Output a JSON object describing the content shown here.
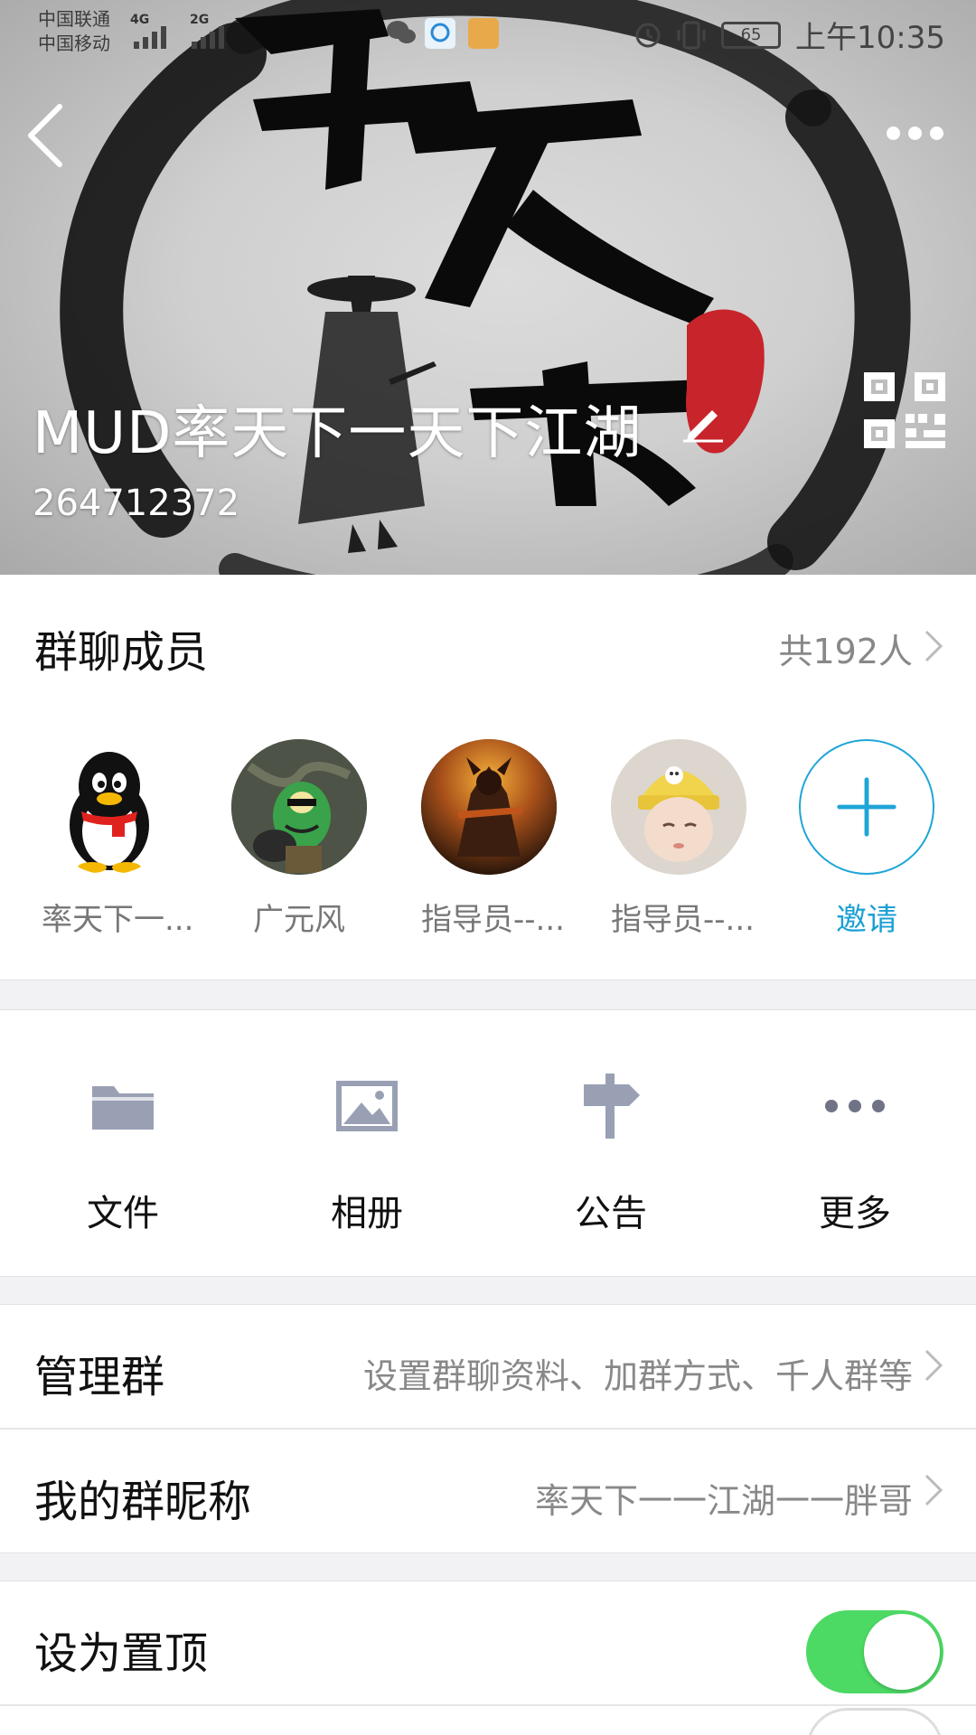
{
  "status_bar": {
    "carrier_1": "中国联通",
    "carrier_2": "中国移动",
    "net_1": "4G",
    "net_2": "2G",
    "battery": "65",
    "time": "上午10:35"
  },
  "header": {
    "group_name": "MUD率天下一天下江湖",
    "group_id": "264712372"
  },
  "members": {
    "title": "群聊成员",
    "count_label": "共192人",
    "items": [
      {
        "name": "率天下一..."
      },
      {
        "name": "广元风"
      },
      {
        "name": "指导员--..."
      },
      {
        "name": "指导员--..."
      }
    ],
    "invite_label": "邀请"
  },
  "actions": [
    {
      "label": "文件",
      "icon": "folder-icon"
    },
    {
      "label": "相册",
      "icon": "image-icon"
    },
    {
      "label": "公告",
      "icon": "signpost-icon"
    },
    {
      "label": "更多",
      "icon": "more-dots-icon"
    }
  ],
  "rows": {
    "manage": {
      "label": "管理群",
      "value": "设置群聊资料、加群方式、千人群等"
    },
    "nickname": {
      "label": "我的群昵称",
      "value": "率天下一一江湖一一胖哥"
    },
    "pin": {
      "label": "设为置顶",
      "enabled": true
    }
  },
  "colors": {
    "accent": "#1fa5d6",
    "toggle_on": "#4cd964",
    "icon_gray": "#9aa0b4"
  }
}
